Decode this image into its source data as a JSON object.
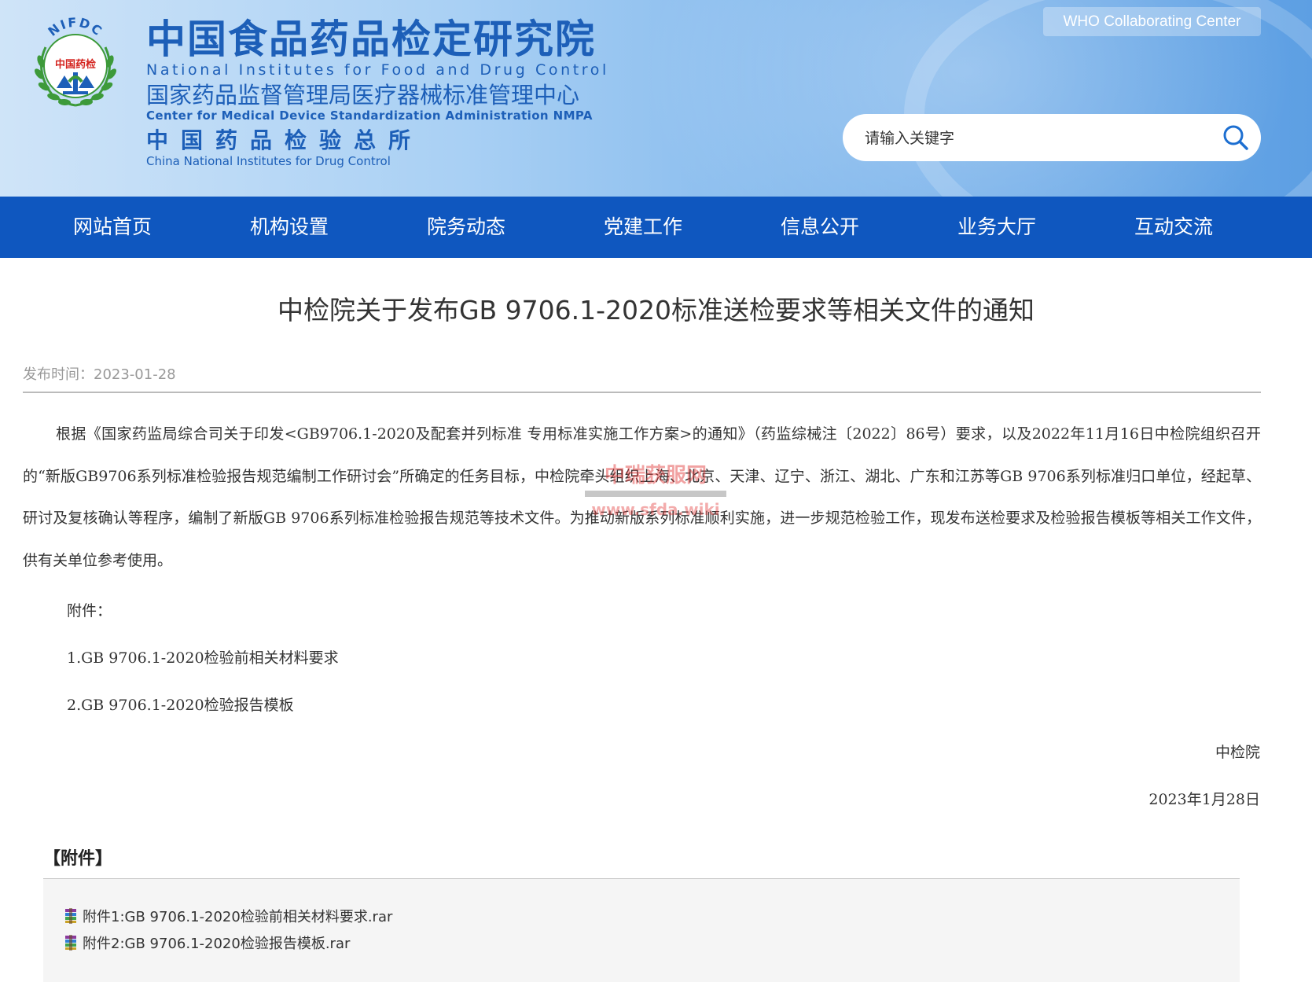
{
  "header": {
    "logo_arc_text": "NIFDC",
    "logo_center_text": "中国药检",
    "title_cn": "中国食品药品检定研究院",
    "title_en": "National Institutes for Food and Drug Control",
    "subtitle_cn": "国家药品监督管理局医疗器械标准管理中心",
    "subtitle_en": "Center for Medical Device Standardization Administration NMPA",
    "subtitle2_cn": "中国药品检验总所",
    "subtitle2_en": "China National Institutes for Drug Control",
    "who_badge": "WHO Collaborating Center",
    "search": {
      "placeholder": "请输入关键字",
      "icon": "search-icon"
    }
  },
  "nav": {
    "items": [
      "网站首页",
      "机构设置",
      "院务动态",
      "党建工作",
      "信息公开",
      "业务大厅",
      "互动交流"
    ]
  },
  "article": {
    "title": "中检院关于发布GB 9706.1-2020标准送检要求等相关文件的通知",
    "publish_time": "发布时间：2023-01-28",
    "body": "根据《国家药监局综合司关于印发<GB9706.1-2020及配套并列标准 专用标准实施工作方案>的通知》（药监综械注〔2022〕86号）要求，以及2022年11月16日中检院组织召开的“新版GB9706系列标准检验报告规范编制工作研讨会”所确定的任务目标，中检院牵头组织上海、北京、天津、辽宁、浙江、湖北、广东和江苏等GB 9706系列标准归口单位，经起草、研讨及复核确认等程序，编制了新版GB 9706系列标准检验报告规范等技术文件。为推动新版系列标准顺利实施，进一步规范检验工作，现发布送检要求及检验报告模板等相关工作文件，供有关单位参考使用。",
    "attachments_label": "附件：",
    "attachment_lines": [
      "1.GB 9706.1-2020检验前相关材料要求",
      "2.GB 9706.1-2020检验报告模板"
    ],
    "signature": "中检院",
    "date": "2023年1月28日",
    "watermark_line1": "中瑞获服网",
    "watermark_line2": "www.sfda.wiki"
  },
  "attachments": {
    "heading": "【附件】",
    "files": [
      {
        "name": "附件1:GB 9706.1-2020检验前相关材料要求.rar",
        "icon": "rar-file-icon"
      },
      {
        "name": "附件2:GB 9706.1-2020检验报告模板.rar",
        "icon": "rar-file-icon"
      }
    ]
  },
  "colors": {
    "nav_bg": "#0f57bf",
    "brand_blue": "#1d5fb8",
    "logo_green": "#3d9a3a",
    "watermark_red": "#e03030"
  }
}
